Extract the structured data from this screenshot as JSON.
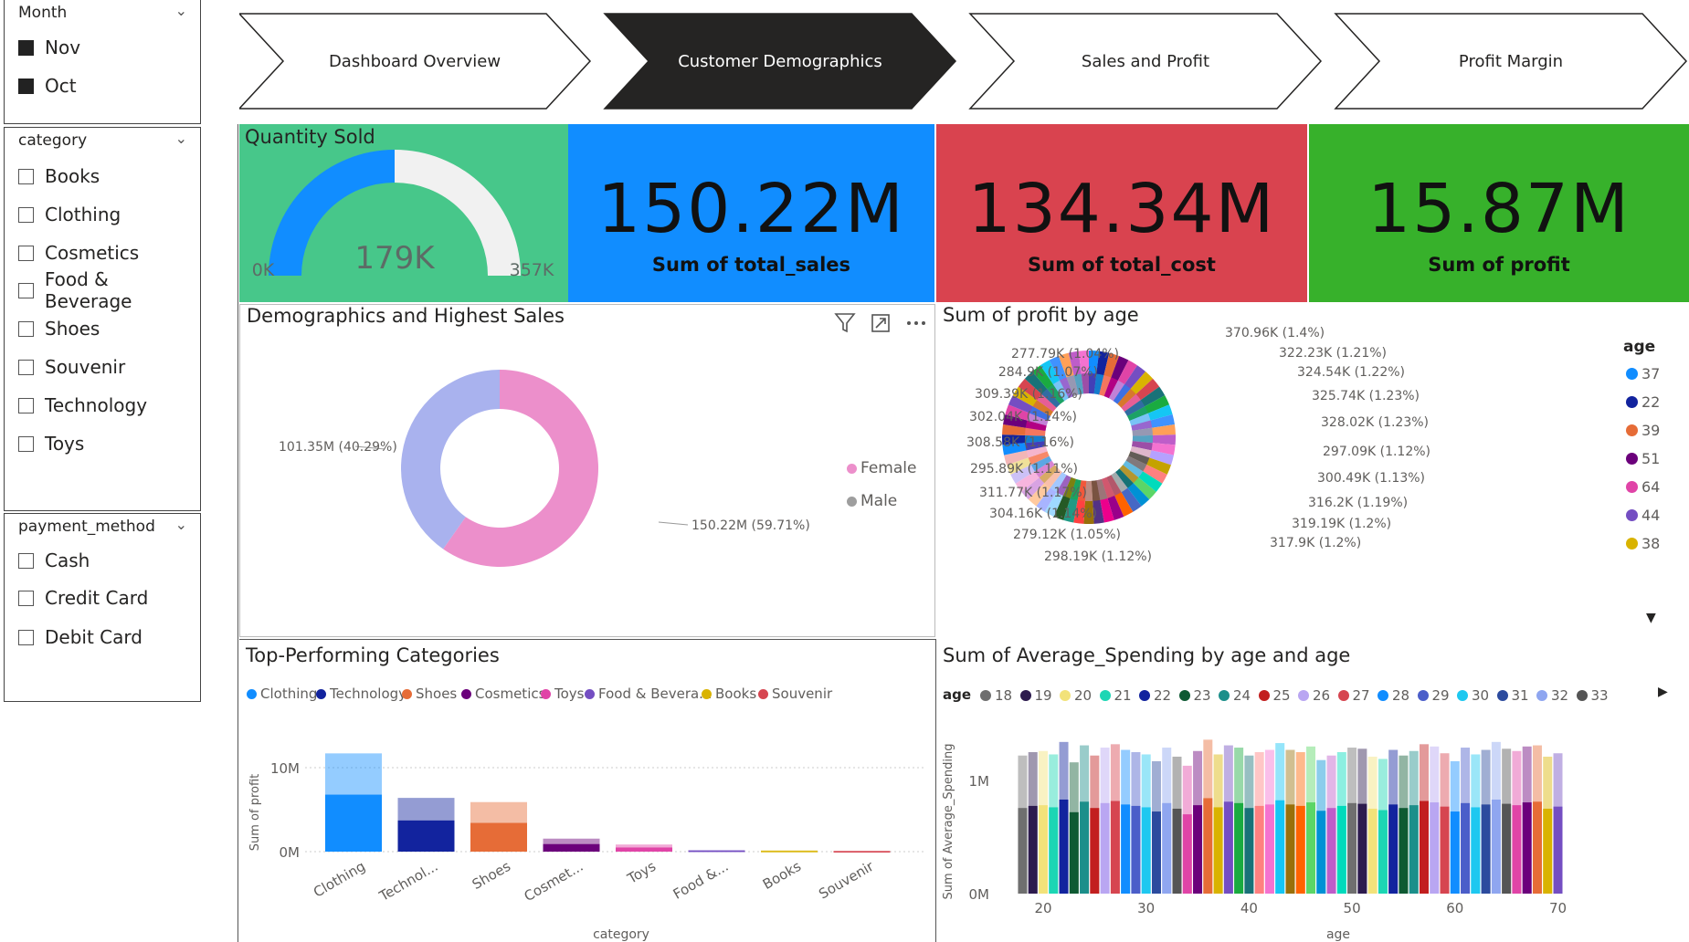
{
  "slicers": {
    "month": {
      "title": "Month",
      "options": [
        {
          "label": "Nov",
          "checked": true
        },
        {
          "label": "Oct",
          "checked": true
        }
      ]
    },
    "category": {
      "title": "category",
      "options": [
        {
          "label": "Books"
        },
        {
          "label": "Clothing"
        },
        {
          "label": "Cosmetics"
        },
        {
          "label": "Food & Beverage"
        },
        {
          "label": "Shoes"
        },
        {
          "label": "Souvenir"
        },
        {
          "label": "Technology"
        },
        {
          "label": "Toys"
        }
      ]
    },
    "payment": {
      "title": "payment_method",
      "options": [
        {
          "label": "Cash"
        },
        {
          "label": "Credit Card"
        },
        {
          "label": "Debit Card"
        }
      ]
    }
  },
  "nav": [
    {
      "label": "Dashboard Overview",
      "active": false
    },
    {
      "label": "Customer Demographics",
      "active": true
    },
    {
      "label": "Sales and Profit",
      "active": false
    },
    {
      "label": "Profit Margin",
      "active": false
    }
  ],
  "gauge": {
    "title": "Quantity Sold",
    "value_label": "179K",
    "min_label": "0K",
    "max_label": "357K",
    "fraction": 0.5
  },
  "kpis": [
    {
      "value": "150.22M",
      "label": "Sum of total_sales",
      "color": "#118dff"
    },
    {
      "value": "134.34M",
      "label": "Sum of total_cost",
      "color": "#d9434f"
    },
    {
      "value": "15.87M",
      "label": "Sum of profit",
      "color": "#37b12b"
    }
  ],
  "donut_gender": {
    "title": "Demographics and Highest Sales",
    "legend": [
      {
        "label": "Female",
        "color": "#ec8fcb"
      },
      {
        "label": "Male",
        "color": "#9e9e9e"
      }
    ],
    "slices": [
      {
        "name": "Female",
        "value": 150.22,
        "label": "150.22M (59.71%)",
        "color": "#ec8fcb"
      },
      {
        "name": "Male",
        "value": 101.35,
        "label": "101.35M (40.29%)",
        "color": "#a9b2ee"
      }
    ]
  },
  "donut_age": {
    "title": "Sum of profit by age",
    "legend_title": "age",
    "legend": [
      {
        "label": "37",
        "color": "#118dff"
      },
      {
        "label": "22",
        "color": "#12239e"
      },
      {
        "label": "39",
        "color": "#e66c37"
      },
      {
        "label": "51",
        "color": "#6b007b"
      },
      {
        "label": "64",
        "color": "#e044a7"
      },
      {
        "label": "44",
        "color": "#744ec2"
      },
      {
        "label": "38",
        "color": "#d9b300"
      }
    ],
    "labels": [
      "370.96K (1.4%)",
      "322.23K (1.21%)",
      "324.54K (1.22%)",
      "325.74K (1.23%)",
      "328.02K (1.23%)",
      "297.09K (1.12%)",
      "300.49K (1.13%)",
      "316.2K (1.19%)",
      "319.19K (1.2%)",
      "317.9K (1.2%)",
      "298.19K (1.12%)",
      "279.12K (1.05%)",
      "304.16K (1.14%)",
      "311.77K (1.17%)",
      "295.89K (1.11%)",
      "308.58K (1.16%)",
      "302.04K (1.14%)",
      "309.39K (1.16%)",
      "284.9K (1.07%)",
      "277.79K (1.04%)"
    ]
  },
  "bar_categories": {
    "title": "Top-Performing Categories",
    "legend": [
      {
        "label": "Clothing",
        "color": "#118dff"
      },
      {
        "label": "Technology",
        "color": "#12239e"
      },
      {
        "label": "Shoes",
        "color": "#e66c37"
      },
      {
        "label": "Cosmetics",
        "color": "#6b007b"
      },
      {
        "label": "Toys",
        "color": "#e044a7"
      },
      {
        "label": "Food & Bevera...",
        "color": "#744ec2"
      },
      {
        "label": "Books",
        "color": "#d9b300"
      },
      {
        "label": "Souvenir",
        "color": "#d64550"
      }
    ],
    "ylabel": "Sum of profit",
    "xlabel": "category",
    "yticks": [
      "10M",
      "0M"
    ]
  },
  "bar_age": {
    "title": "Sum of Average_Spending by age and age",
    "legend_title": "age",
    "legend": [
      {
        "label": "18",
        "color": "#6f6f6f"
      },
      {
        "label": "19",
        "color": "#2d1b4e"
      },
      {
        "label": "20",
        "color": "#f2e27a"
      },
      {
        "label": "21",
        "color": "#1cd6b4"
      },
      {
        "label": "22",
        "color": "#12239e"
      },
      {
        "label": "23",
        "color": "#0e5a33"
      },
      {
        "label": "24",
        "color": "#1c8f8a"
      },
      {
        "label": "25",
        "color": "#c21f1f"
      },
      {
        "label": "26",
        "color": "#b9a6f2"
      },
      {
        "label": "27",
        "color": "#d64550"
      },
      {
        "label": "28",
        "color": "#118dff"
      },
      {
        "label": "29",
        "color": "#4b5ec9"
      },
      {
        "label": "30",
        "color": "#1ec8f0"
      },
      {
        "label": "31",
        "color": "#2c4b9e"
      },
      {
        "label": "32",
        "color": "#8fa6f0"
      },
      {
        "label": "33",
        "color": "#555555"
      }
    ],
    "ylabel": "Sum of Average_Spending",
    "xlabel": "age",
    "yticks": [
      "1M",
      "0M"
    ],
    "xticks": [
      "20",
      "30",
      "40",
      "50",
      "60",
      "70"
    ]
  },
  "chart_data": [
    {
      "type": "pie",
      "title": "Demographics and Highest Sales",
      "categories": [
        "Female",
        "Male"
      ],
      "values": [
        150.22,
        101.35
      ],
      "unit": "M"
    },
    {
      "type": "bar",
      "title": "Top-Performing Categories",
      "categories": [
        "Clothing",
        "Technology",
        "Shoes",
        "Cosmetics",
        "Toys",
        "Food & Beverage",
        "Books",
        "Souvenir"
      ],
      "values": [
        11.7,
        6.4,
        5.9,
        1.55,
        0.85,
        0.2,
        0.15,
        0.1
      ],
      "xlabel": "category",
      "ylabel": "Sum of profit",
      "ylim": [
        0,
        12.5
      ]
    },
    {
      "type": "bar",
      "title": "Sum of Average_Spending by age and age",
      "x": [
        18,
        19,
        20,
        21,
        22,
        23,
        24,
        25,
        26,
        27,
        28,
        29,
        30,
        31,
        32,
        33,
        34,
        35,
        36,
        37,
        38,
        39,
        40,
        41,
        42,
        43,
        44,
        45,
        46,
        47,
        48,
        49,
        50,
        51,
        52,
        53,
        54,
        55,
        56,
        57,
        58,
        59,
        60,
        61,
        62,
        63,
        64,
        65,
        66,
        67,
        68,
        69,
        70
      ],
      "values": [
        1.22,
        1.25,
        1.26,
        1.23,
        1.34,
        1.16,
        1.31,
        1.22,
        1.29,
        1.32,
        1.27,
        1.25,
        1.23,
        1.17,
        1.29,
        1.21,
        1.13,
        1.26,
        1.36,
        1.23,
        1.31,
        1.29,
        1.22,
        1.25,
        1.27,
        1.33,
        1.27,
        1.25,
        1.3,
        1.18,
        1.22,
        1.25,
        1.29,
        1.28,
        1.21,
        1.19,
        1.27,
        1.22,
        1.26,
        1.32,
        1.3,
        1.24,
        1.17,
        1.29,
        1.23,
        1.27,
        1.34,
        1.28,
        1.26,
        1.3,
        1.31,
        1.21,
        1.24
      ],
      "xlabel": "age",
      "ylabel": "Sum of Average_Spending"
    }
  ]
}
